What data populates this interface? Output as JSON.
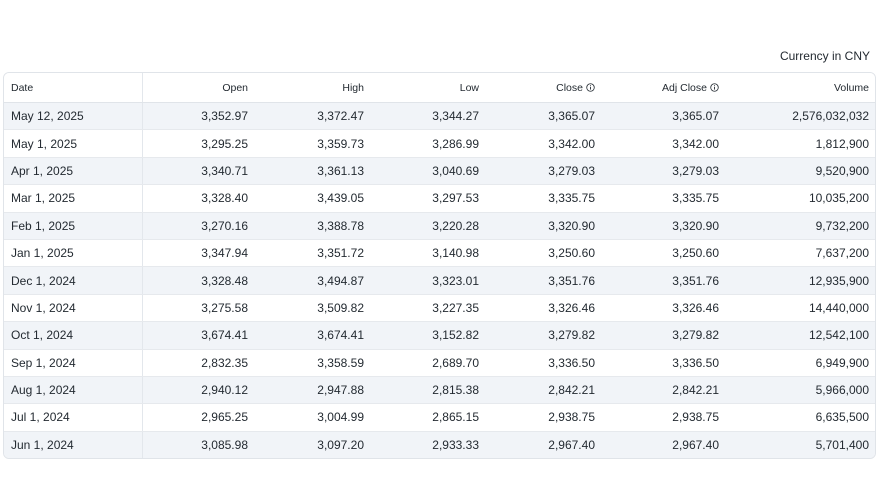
{
  "currency_note": "Currency in CNY",
  "columns": {
    "date": "Date",
    "open": "Open",
    "high": "High",
    "low": "Low",
    "close": "Close",
    "adj_close": "Adj Close",
    "volume": "Volume"
  },
  "icons": {
    "close_info": "info-circle-icon",
    "adj_close_info": "info-circle-icon"
  },
  "rows": [
    {
      "date": "May 12, 2025",
      "open": "3,352.97",
      "high": "3,372.47",
      "low": "3,344.27",
      "close": "3,365.07",
      "adj_close": "3,365.07",
      "volume": "2,576,032,032"
    },
    {
      "date": "May 1, 2025",
      "open": "3,295.25",
      "high": "3,359.73",
      "low": "3,286.99",
      "close": "3,342.00",
      "adj_close": "3,342.00",
      "volume": "1,812,900"
    },
    {
      "date": "Apr 1, 2025",
      "open": "3,340.71",
      "high": "3,361.13",
      "low": "3,040.69",
      "close": "3,279.03",
      "adj_close": "3,279.03",
      "volume": "9,520,900"
    },
    {
      "date": "Mar 1, 2025",
      "open": "3,328.40",
      "high": "3,439.05",
      "low": "3,297.53",
      "close": "3,335.75",
      "adj_close": "3,335.75",
      "volume": "10,035,200"
    },
    {
      "date": "Feb 1, 2025",
      "open": "3,270.16",
      "high": "3,388.78",
      "low": "3,220.28",
      "close": "3,320.90",
      "adj_close": "3,320.90",
      "volume": "9,732,200"
    },
    {
      "date": "Jan 1, 2025",
      "open": "3,347.94",
      "high": "3,351.72",
      "low": "3,140.98",
      "close": "3,250.60",
      "adj_close": "3,250.60",
      "volume": "7,637,200"
    },
    {
      "date": "Dec 1, 2024",
      "open": "3,328.48",
      "high": "3,494.87",
      "low": "3,323.01",
      "close": "3,351.76",
      "adj_close": "3,351.76",
      "volume": "12,935,900"
    },
    {
      "date": "Nov 1, 2024",
      "open": "3,275.58",
      "high": "3,509.82",
      "low": "3,227.35",
      "close": "3,326.46",
      "adj_close": "3,326.46",
      "volume": "14,440,000"
    },
    {
      "date": "Oct 1, 2024",
      "open": "3,674.41",
      "high": "3,674.41",
      "low": "3,152.82",
      "close": "3,279.82",
      "adj_close": "3,279.82",
      "volume": "12,542,100"
    },
    {
      "date": "Sep 1, 2024",
      "open": "2,832.35",
      "high": "3,358.59",
      "low": "2,689.70",
      "close": "3,336.50",
      "adj_close": "3,336.50",
      "volume": "6,949,900"
    },
    {
      "date": "Aug 1, 2024",
      "open": "2,940.12",
      "high": "2,947.88",
      "low": "2,815.38",
      "close": "2,842.21",
      "adj_close": "2,842.21",
      "volume": "5,966,000"
    },
    {
      "date": "Jul 1, 2024",
      "open": "2,965.25",
      "high": "3,004.99",
      "low": "2,865.15",
      "close": "2,938.75",
      "adj_close": "2,938.75",
      "volume": "6,635,500"
    },
    {
      "date": "Jun 1, 2024",
      "open": "3,085.98",
      "high": "3,097.20",
      "low": "2,933.33",
      "close": "2,967.40",
      "adj_close": "2,967.40",
      "volume": "5,701,400"
    }
  ]
}
